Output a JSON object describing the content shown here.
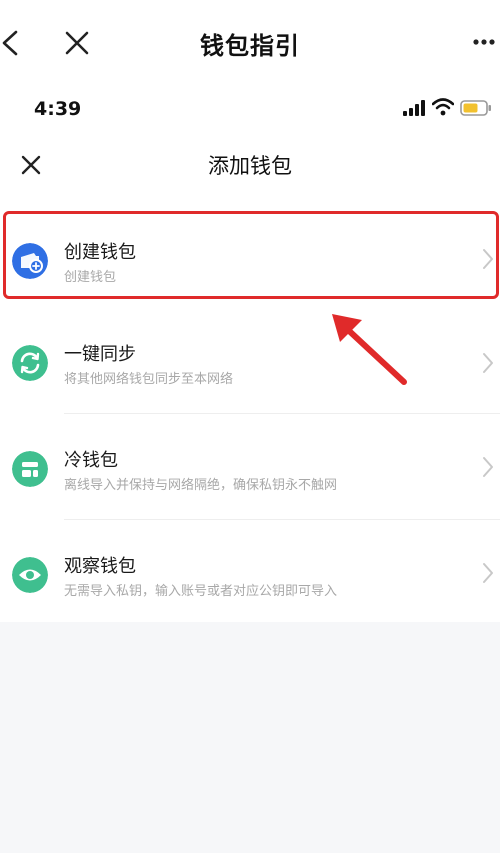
{
  "wechat_bar": {
    "title": "钱包指引"
  },
  "status_bar": {
    "time": "4:39"
  },
  "page": {
    "title": "添加钱包"
  },
  "items": [
    {
      "title": "创建钱包",
      "subtitle": "创建钱包",
      "icon": "wallet-add-icon",
      "color": "#2f6fe4"
    },
    {
      "title": "一键同步",
      "subtitle": "将其他网络钱包同步至本网络",
      "icon": "sync-icon",
      "color": "#3fbf8f"
    },
    {
      "title": "冷钱包",
      "subtitle": "离线导入并保持与网络隔绝，确保私钥永不触网",
      "icon": "cold-wallet-icon",
      "color": "#3fbf8f"
    },
    {
      "title": "观察钱包",
      "subtitle": "无需导入私钥，输入账号或者对应公钥即可导入",
      "icon": "eye-icon",
      "color": "#3fbf8f"
    }
  ],
  "colors": {
    "highlight": "#e02a2a",
    "primary_icon": "#2f6fe4",
    "green_icon": "#3fbf8f",
    "subtitle": "#a8a8a8"
  }
}
